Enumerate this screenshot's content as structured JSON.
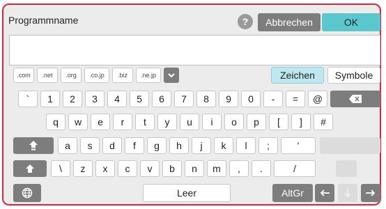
{
  "dialog": {
    "title": "Programmname",
    "help_icon": "?",
    "cancel_label": "Abbrechen",
    "ok_label": "OK",
    "input_value": ""
  },
  "domain_keys": [
    ".com",
    ".net",
    ".org",
    ".co.jp",
    ".biz",
    ".ne.jp"
  ],
  "tabs": {
    "zeichen": "Zeichen",
    "symbole": "Symbole"
  },
  "rows": {
    "row1": [
      "`",
      "1",
      "2",
      "3",
      "4",
      "5",
      "6",
      "7",
      "8",
      "9",
      "0",
      "-",
      "="
    ],
    "row1_extra": "@",
    "row2": [
      "q",
      "w",
      "e",
      "r",
      "t",
      "y",
      "u",
      "i",
      "o",
      "p",
      "[",
      "]",
      "#"
    ],
    "row3": [
      "a",
      "s",
      "d",
      "f",
      "g",
      "h",
      "j",
      "k",
      "l",
      ";",
      "'"
    ],
    "row4": [
      "\\",
      "z",
      "x",
      "c",
      "v",
      "b",
      "n",
      "m",
      ",",
      ".",
      "/"
    ]
  },
  "bottom": {
    "space_label": "Leer",
    "altgr_label": "AltGr"
  },
  "icons": {
    "help": "question-mark-icon",
    "dropdown": "chevron-down-icon",
    "backspace": "backspace-icon",
    "caps": "caps-lock-icon",
    "shift": "shift-arrow-icon",
    "globe": "globe-icon",
    "left": "arrow-left-icon",
    "down": "arrow-down-icon",
    "right": "arrow-right-icon"
  },
  "colors": {
    "frame_border": "#e0233a",
    "accent_ok": "#5bc7cf",
    "dark_key": "#7d7d7d",
    "tab_active": "#bfe7ef"
  }
}
